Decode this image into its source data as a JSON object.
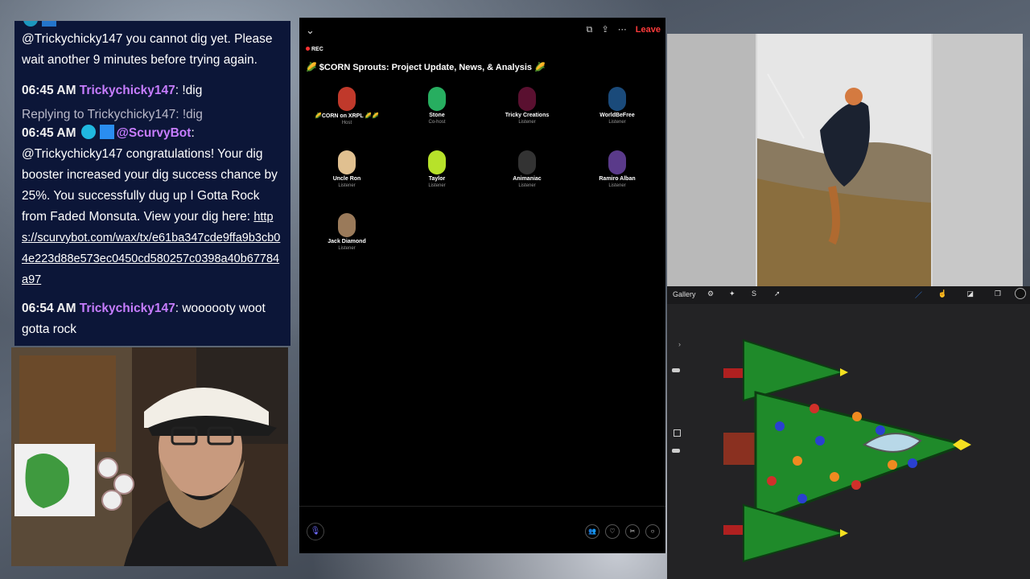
{
  "chat": {
    "partial_top": "@Trickychicky147 you cannot dig yet. Please wait another 9 minutes before trying again.",
    "msg1": {
      "time": "06:45 AM",
      "user": "Trickychicky147",
      "text": ": !dig"
    },
    "reply_to": "Replying to Trickychicky147: !dig",
    "msg2": {
      "time": "06:45 AM",
      "user": "@ScurvyBot",
      "text": "@Trickychicky147 congratulations! Your dig booster increased your dig success chance by 25%. You successfully dug up I Gotta Rock from Faded Monsuta. View your dig here: ",
      "link": "https://scurvybot.com/wax/tx/e61ba347cde9ffa9b3cb04e223d88e573ec0450cd580257c0398a40b67784a97"
    },
    "msg3": {
      "time": "06:54 AM",
      "user": "Trickychicky147",
      "text": ": woooooty woot gotta rock"
    }
  },
  "spaces": {
    "rec": "REC",
    "leave": "Leave",
    "title": "🌽 $CORN Sprouts: Project Update, News, & Analysis 🌽",
    "participants": [
      {
        "name": "🌽CORN on XRPL 🌽🌽",
        "role": "Host",
        "color": "#c0392b"
      },
      {
        "name": "Stone",
        "role": "Co-host",
        "color": "#27ae60"
      },
      {
        "name": "Tricky Creations",
        "role": "Listener",
        "color": "#5a1030"
      },
      {
        "name": "WorldBeFree",
        "role": "Listener",
        "color": "#1a4a7a"
      },
      {
        "name": "Uncle Ron",
        "role": "Listener",
        "color": "#e0c090"
      },
      {
        "name": "Taylor",
        "role": "Listener",
        "color": "#b7e22a"
      },
      {
        "name": "Animaniac",
        "role": "Listener",
        "color": "#333333"
      },
      {
        "name": "Ramiro Alban",
        "role": "Listener",
        "color": "#5a3a8a"
      },
      {
        "name": "Jack Diamond",
        "role": "Listener",
        "color": "#9a7a5a"
      }
    ]
  },
  "procreate": {
    "gallery": "Gallery"
  }
}
